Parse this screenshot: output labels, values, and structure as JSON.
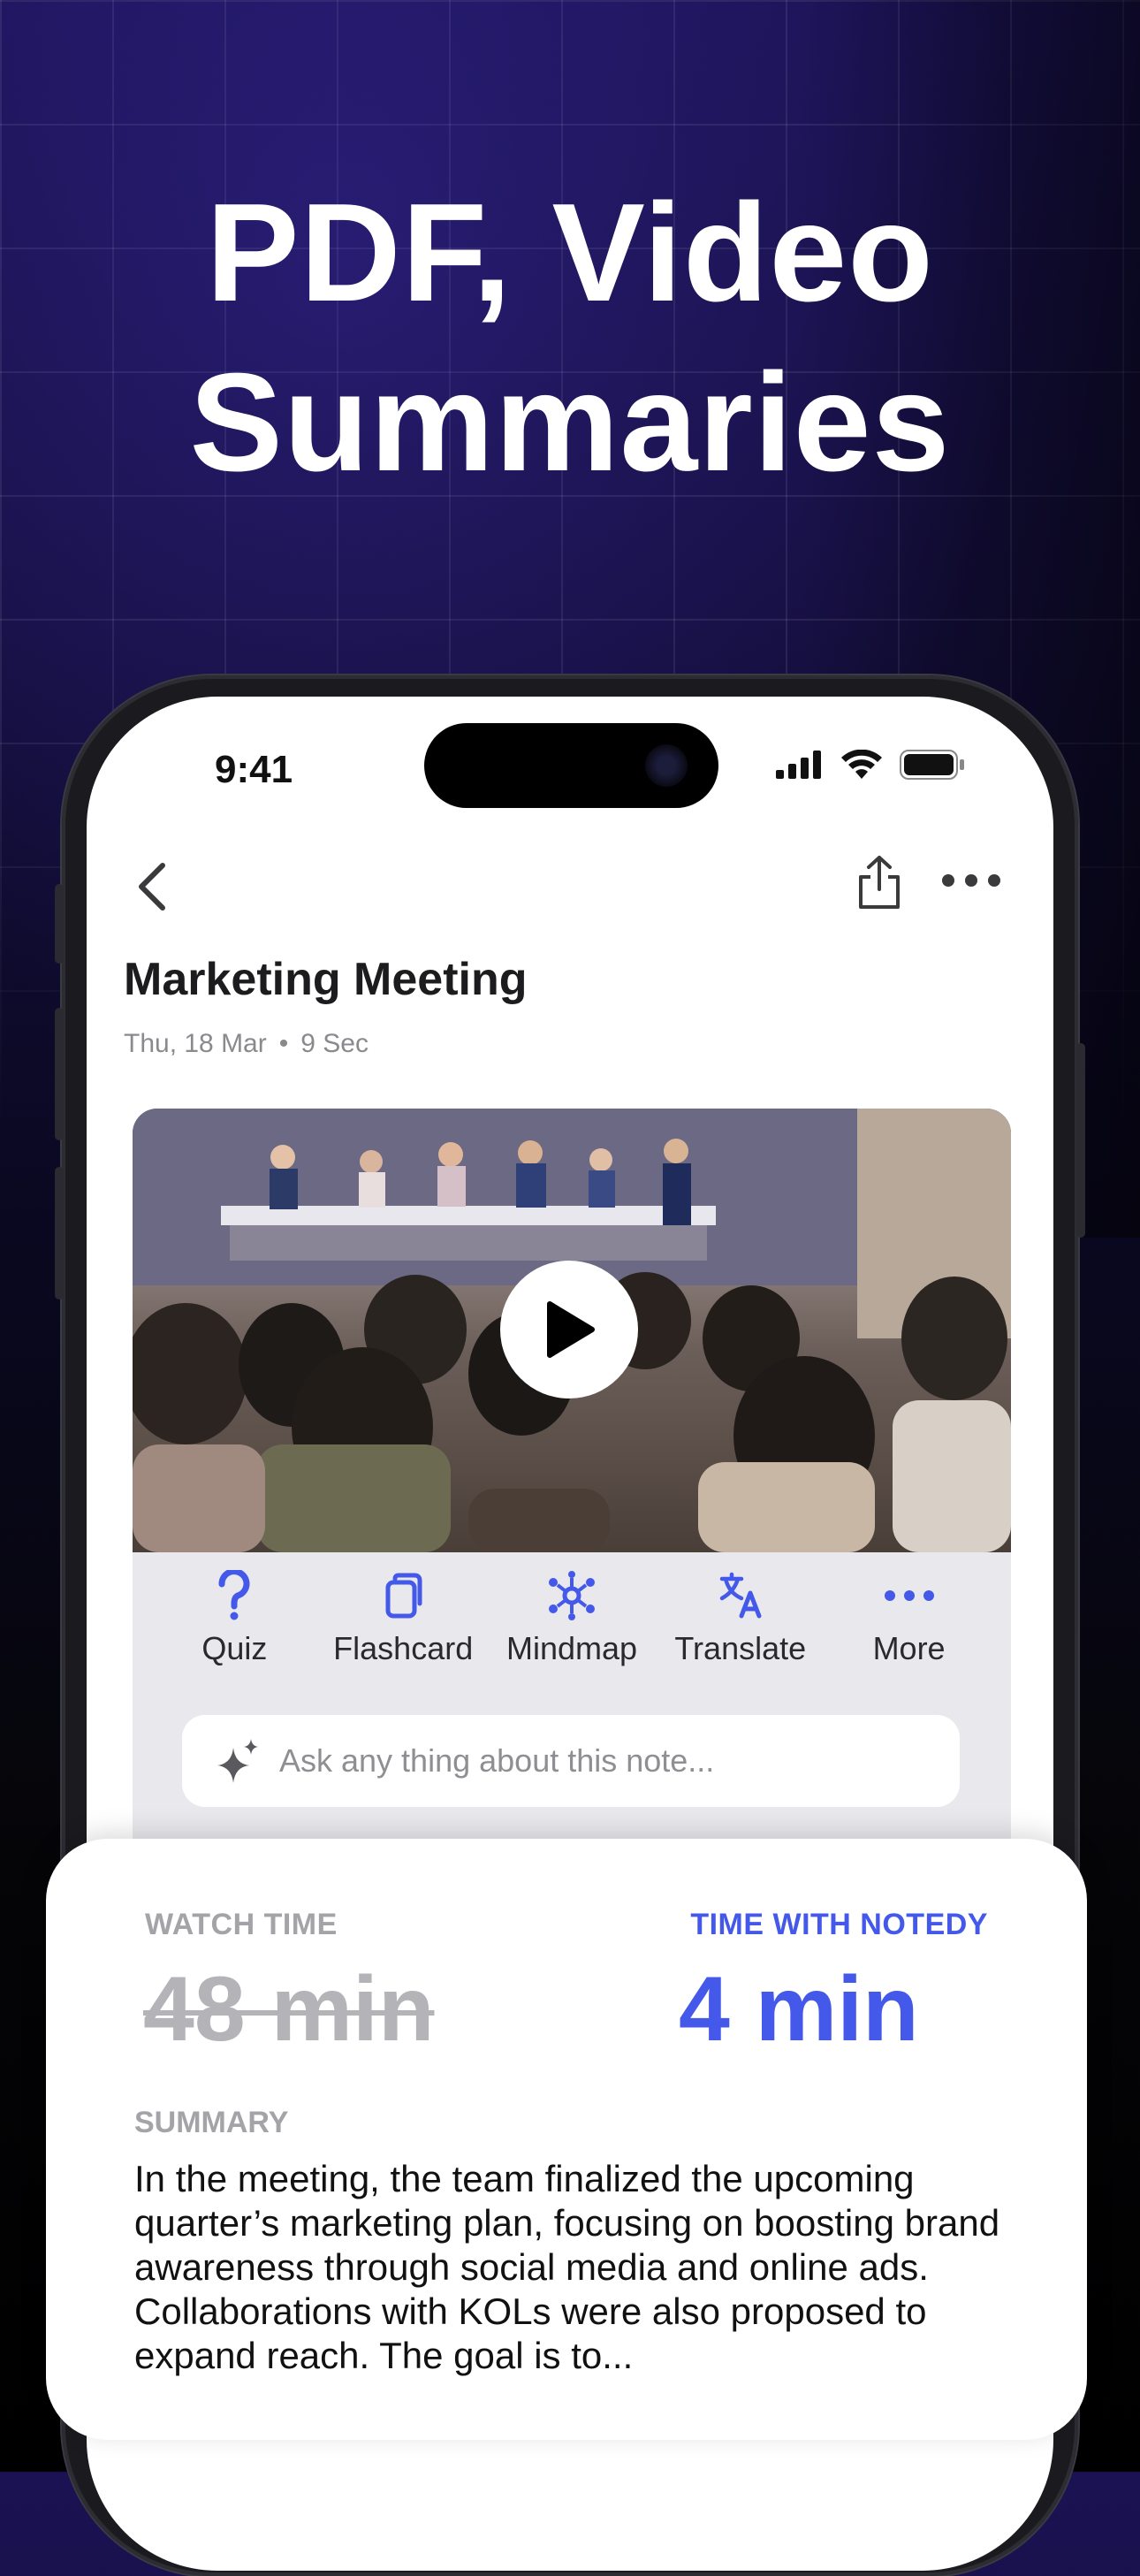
{
  "headline": {
    "line1": "PDF, Video",
    "line2": "Summaries"
  },
  "status_bar": {
    "time": "9:41"
  },
  "note": {
    "title": "Marketing Meeting",
    "date": "Thu, 18 Mar",
    "duration": "9 Sec"
  },
  "actions": [
    {
      "label": "Quiz",
      "icon": "question-icon"
    },
    {
      "label": "Flashcard",
      "icon": "flashcard-icon"
    },
    {
      "label": "Mindmap",
      "icon": "mindmap-icon"
    },
    {
      "label": "Translate",
      "icon": "translate-icon"
    },
    {
      "label": "More",
      "icon": "more-dots-icon"
    }
  ],
  "ask": {
    "placeholder": "Ask any thing about this note..."
  },
  "comparison": {
    "watch_label": "WATCH TIME",
    "watch_value": "48 min",
    "notedy_label": "TIME WITH NOTEDY",
    "notedy_value": "4 min"
  },
  "summary": {
    "label": "SUMMARY",
    "text": "In the meeting, the team finalized the upcoming quarter’s marketing plan, focusing on boosting brand awareness through social media and online ads. Collaborations with KOLs were also proposed to expand reach. The goal is to..."
  },
  "colors": {
    "accent": "#4459ea",
    "muted": "#a4a4a8"
  }
}
